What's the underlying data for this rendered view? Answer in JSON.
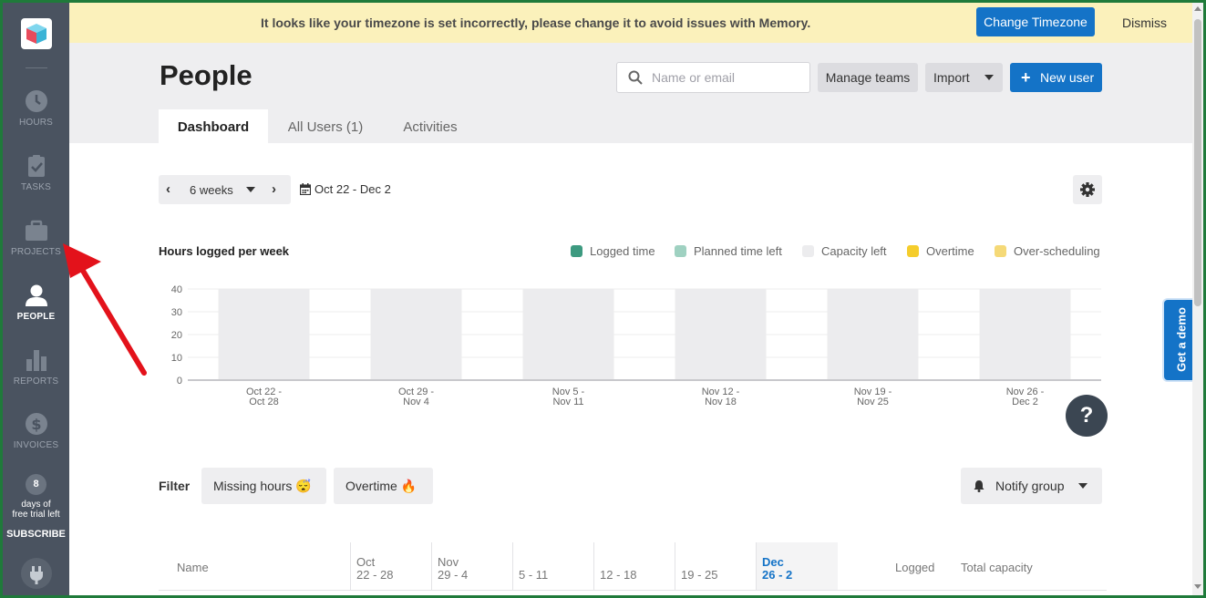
{
  "banner": {
    "message": "It looks like your timezone is set incorrectly, please change it to avoid issues with Memory.",
    "change_label": "Change Timezone",
    "dismiss_label": "Dismiss"
  },
  "sidebar": {
    "items": [
      {
        "label": "HOURS",
        "icon": "clock-icon"
      },
      {
        "label": "TASKS",
        "icon": "clipboard-check-icon"
      },
      {
        "label": "PROJECTS",
        "icon": "briefcase-icon"
      },
      {
        "label": "PEOPLE",
        "icon": "person-icon",
        "active": true
      },
      {
        "label": "REPORTS",
        "icon": "bar-chart-icon"
      },
      {
        "label": "INVOICES",
        "icon": "dollar-icon"
      }
    ],
    "trial_days": "8",
    "trial_text_1": "days of",
    "trial_text_2": "free trial left",
    "subscribe_label": "SUBSCRIBE"
  },
  "header": {
    "title": "People",
    "search_placeholder": "Name or email",
    "manage_teams_label": "Manage teams",
    "import_label": "Import",
    "new_user_plus": "+",
    "new_user_label": "New user",
    "tabs": [
      {
        "label": "Dashboard",
        "active": true
      },
      {
        "label": "All Users (1)"
      },
      {
        "label": "Activities"
      }
    ]
  },
  "toolbar": {
    "period_value": "6 weeks",
    "date_range": "Oct 22 - Dec 2"
  },
  "chart_section": {
    "title": "Hours logged per week",
    "legend": [
      {
        "label": "Logged time",
        "color": "#3d9a80"
      },
      {
        "label": "Planned time left",
        "color": "#9fd1c1"
      },
      {
        "label": "Capacity left",
        "color": "#ececee"
      },
      {
        "label": "Overtime",
        "color": "#f5cd2c"
      },
      {
        "label": "Over-scheduling",
        "color": "#f5d977"
      }
    ]
  },
  "chart_data": {
    "type": "bar",
    "categories": [
      "Oct 22 - Oct 28",
      "Oct 29 - Nov 4",
      "Nov 5 - Nov 11",
      "Nov 12 - Nov 18",
      "Nov 19 - Nov 25",
      "Nov 26 - Dec 2"
    ],
    "category_lines": [
      [
        "Oct 22 -",
        "Oct 28"
      ],
      [
        "Oct 29 -",
        "Nov 4"
      ],
      [
        "Nov 5 -",
        "Nov 11"
      ],
      [
        "Nov 12 -",
        "Nov 18"
      ],
      [
        "Nov 19 -",
        "Nov 25"
      ],
      [
        "Nov 26 -",
        "Dec 2"
      ]
    ],
    "series": [
      {
        "name": "Logged time",
        "values": [
          0,
          0,
          0,
          0,
          0,
          0
        ]
      },
      {
        "name": "Planned time left",
        "values": [
          0,
          0,
          0,
          0,
          0,
          0
        ]
      },
      {
        "name": "Capacity left",
        "values": [
          40,
          40,
          40,
          40,
          40,
          40
        ]
      },
      {
        "name": "Overtime",
        "values": [
          0,
          0,
          0,
          0,
          0,
          0
        ]
      },
      {
        "name": "Over-scheduling",
        "values": [
          0,
          0,
          0,
          0,
          0,
          0
        ]
      }
    ],
    "yticks": [
      0,
      10,
      20,
      30,
      40
    ],
    "ylim": [
      0,
      40
    ],
    "grid": true,
    "legend_position": "top-right"
  },
  "filter": {
    "label": "Filter",
    "missing_hours_label": "Missing hours 😴",
    "overtime_label": "Overtime 🔥",
    "notify_label": "Notify group"
  },
  "table": {
    "name_header": "Name",
    "week_columns": [
      {
        "l1": "Oct",
        "l2": "22 - 28"
      },
      {
        "l1": "Nov",
        "l2": "29 - 4"
      },
      {
        "l1": "",
        "l2": "5 - 11"
      },
      {
        "l1": "",
        "l2": "12 - 18"
      },
      {
        "l1": "",
        "l2": "19 - 25"
      },
      {
        "l1": "Dec",
        "l2": "26 - 2"
      }
    ],
    "logged_header": "Logged",
    "capacity_header": "Total capacity"
  },
  "help_label": "?",
  "demo_label": "Get a demo"
}
